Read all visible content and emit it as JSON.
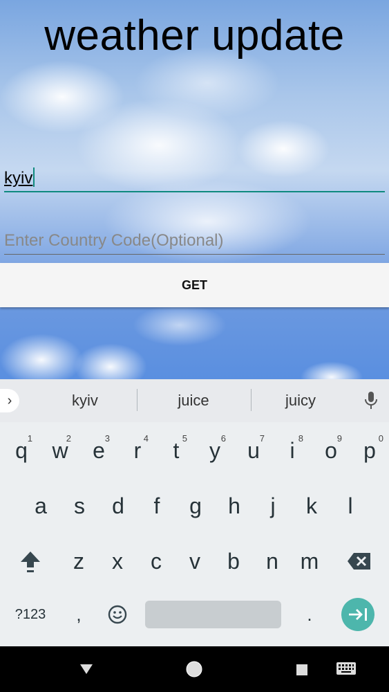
{
  "app": {
    "title": "weather update",
    "city_input_value": "kyiv",
    "country_placeholder": "Enter Country Code(Optional)",
    "get_button_label": "GET"
  },
  "keyboard": {
    "suggestions": [
      "kyiv",
      "juice",
      "juicy"
    ],
    "row1": [
      {
        "key": "q",
        "num": "1"
      },
      {
        "key": "w",
        "num": "2"
      },
      {
        "key": "e",
        "num": "3"
      },
      {
        "key": "r",
        "num": "4"
      },
      {
        "key": "t",
        "num": "5"
      },
      {
        "key": "y",
        "num": "6"
      },
      {
        "key": "u",
        "num": "7"
      },
      {
        "key": "i",
        "num": "8"
      },
      {
        "key": "o",
        "num": "9"
      },
      {
        "key": "p",
        "num": "0"
      }
    ],
    "row2": [
      "a",
      "s",
      "d",
      "f",
      "g",
      "h",
      "j",
      "k",
      "l"
    ],
    "row3": [
      "z",
      "x",
      "c",
      "v",
      "b",
      "n",
      "m"
    ],
    "symbols_label": "?123",
    "comma": ",",
    "period": ".",
    "icons": {
      "expand": "chevron-right-icon",
      "mic": "mic-icon",
      "shift": "shift-icon",
      "backspace": "backspace-icon",
      "emoji": "emoji-icon",
      "enter": "enter-next-icon"
    }
  },
  "navbar": {
    "icons": [
      "back-icon",
      "home-icon",
      "recents-icon",
      "keyboard-switch-icon"
    ]
  },
  "colors": {
    "accent": "#0f8a7e",
    "enter_key": "#4db6ac",
    "keyboard_bg": "#eceff1"
  }
}
